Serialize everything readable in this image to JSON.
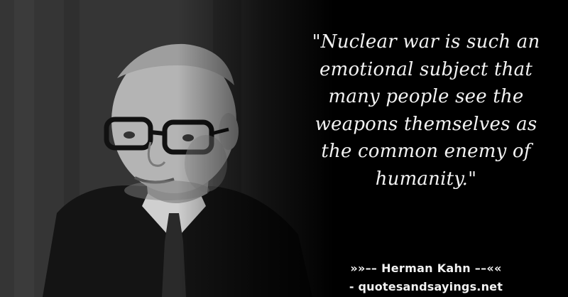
{
  "quote": {
    "text": "\"Nuclear war is such an\nemotional subject that\nmany people see the\nweapons themselves as\nthe common enemy of\nhumanity.\""
  },
  "attribution": {
    "author_line": "»»–– Herman Kahn ––««",
    "site_line": "- quotesandsayings.net"
  },
  "photo": {
    "description_icon": "portrait-photo"
  }
}
